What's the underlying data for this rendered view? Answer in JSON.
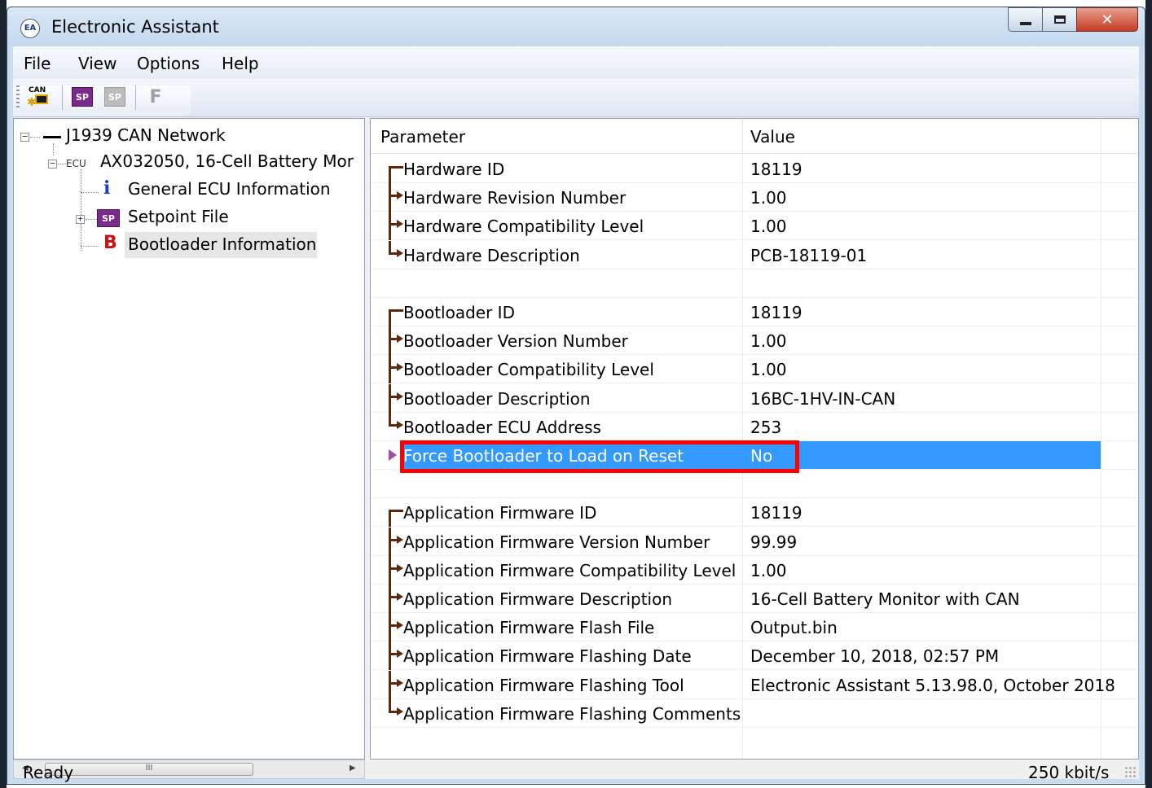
{
  "window": {
    "title": "Electronic Assistant",
    "app_icon": "EA"
  },
  "menu": [
    "File",
    "View",
    "Options",
    "Help"
  ],
  "toolbar": {
    "can_label": "CAN",
    "sp_label": "SP",
    "f_label": "F"
  },
  "tree": {
    "network": "J1939 CAN Network",
    "ecu_tag": "ECU",
    "ecu": "AX032050, 16-Cell Battery Mor",
    "items": [
      {
        "label": "General ECU Information",
        "icon": "info-icon",
        "glyph": "i"
      },
      {
        "label": "Setpoint File",
        "icon": "setpoint-icon",
        "glyph": "SP"
      },
      {
        "label": "Bootloader Information",
        "icon": "bootloader-icon",
        "glyph": "B"
      }
    ],
    "scroll_thumb": "III"
  },
  "grid": {
    "headers": {
      "parameter": "Parameter",
      "value": "Value"
    },
    "rows": [
      {
        "p": "Hardware ID",
        "v": "18119"
      },
      {
        "p": "Hardware Revision Number",
        "v": "1.00"
      },
      {
        "p": "Hardware Compatibility Level",
        "v": "1.00"
      },
      {
        "p": "Hardware Description",
        "v": "PCB-18119-01"
      },
      {
        "p": "",
        "v": ""
      },
      {
        "p": "Bootloader ID",
        "v": "18119"
      },
      {
        "p": "Bootloader Version Number",
        "v": "1.00"
      },
      {
        "p": "Bootloader Compatibility Level",
        "v": "1.00"
      },
      {
        "p": "Bootloader Description",
        "v": "16BC-1HV-IN-CAN"
      },
      {
        "p": "Bootloader ECU Address",
        "v": "253"
      },
      {
        "p": "Force Bootloader to Load on Reset",
        "v": "No"
      },
      {
        "p": "",
        "v": ""
      },
      {
        "p": "Application Firmware ID",
        "v": "18119"
      },
      {
        "p": "Application Firmware Version Number",
        "v": "99.99"
      },
      {
        "p": "Application Firmware Compatibility Level",
        "v": "1.00"
      },
      {
        "p": "Application Firmware Description",
        "v": "16-Cell Battery Monitor with CAN"
      },
      {
        "p": "Application Firmware Flash File",
        "v": "Output.bin"
      },
      {
        "p": "Application Firmware Flashing Date",
        "v": "December 10, 2018, 02:57 PM"
      },
      {
        "p": "Application Firmware Flashing Tool",
        "v": "Electronic Assistant 5.13.98.0, October 2018"
      },
      {
        "p": "Application Firmware Flashing Comments",
        "v": ""
      }
    ]
  },
  "status": {
    "left": "Ready",
    "right": "250 kbit/s"
  },
  "colors": {
    "selection": "#3399ff",
    "highlight_box": "#ff0000",
    "connector": "#5c2a0a"
  }
}
